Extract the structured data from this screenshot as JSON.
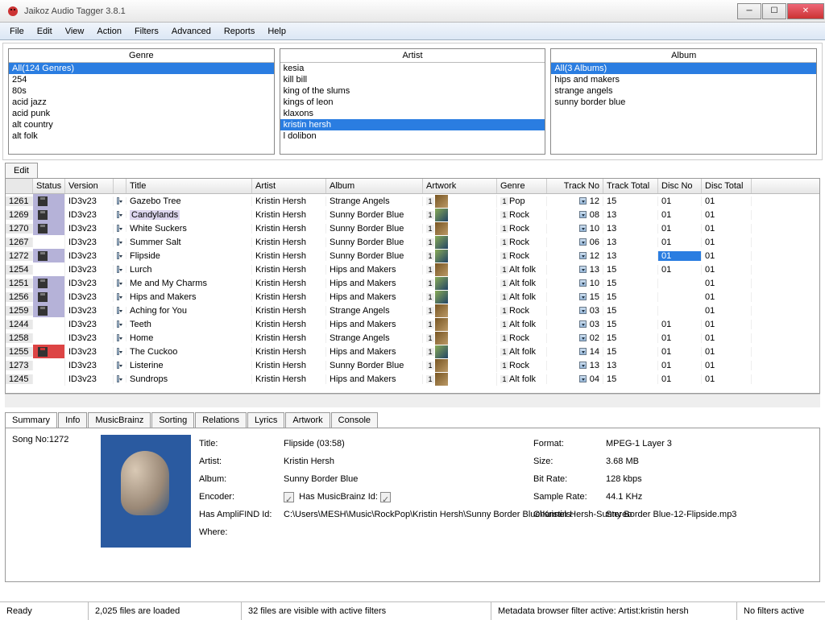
{
  "window": {
    "title": "Jaikoz Audio Tagger 3.8.1"
  },
  "menu": [
    "File",
    "Edit",
    "View",
    "Action",
    "Filters",
    "Advanced",
    "Reports",
    "Help"
  ],
  "filters": {
    "genre": {
      "title": "Genre",
      "items": [
        {
          "t": "All(124 Genres)",
          "sel": true
        },
        {
          "t": "254"
        },
        {
          "t": "80s"
        },
        {
          "t": "acid jazz"
        },
        {
          "t": "acid punk"
        },
        {
          "t": "alt country"
        },
        {
          "t": "alt folk"
        }
      ]
    },
    "artist": {
      "title": "Artist",
      "items": [
        {
          "t": "kesia"
        },
        {
          "t": "kill bill"
        },
        {
          "t": "king of the slums"
        },
        {
          "t": "kings of leon"
        },
        {
          "t": "klaxons"
        },
        {
          "t": "kristin hersh",
          "sel": true
        },
        {
          "t": "l dolibon"
        }
      ]
    },
    "album": {
      "title": "Album",
      "items": [
        {
          "t": "All(3 Albums)",
          "sel": true
        },
        {
          "t": "hips and makers"
        },
        {
          "t": "strange angels"
        },
        {
          "t": "sunny border blue"
        }
      ]
    }
  },
  "editTab": "Edit",
  "columns": [
    "",
    "Status",
    "Version",
    "",
    "Title",
    "Artist",
    "Album",
    "Artwork",
    "Genre",
    "Track No",
    "Track Total",
    "Disc No",
    "Disc Total"
  ],
  "rows": [
    {
      "id": "1261",
      "status": "m",
      "ver": "ID3v23",
      "title": "Gazebo Tree",
      "artist": "Kristin Hersh",
      "album": "Strange Angels",
      "genre": "Pop",
      "tn": "12",
      "tt": "15",
      "dn": "01",
      "dt": "01"
    },
    {
      "id": "1269",
      "status": "m",
      "ver": "ID3v23",
      "title": "Candylands",
      "hl": true,
      "artist": "Kristin Hersh",
      "album": "Sunny Border Blue",
      "genre": "Rock",
      "tn": "08",
      "tt": "13",
      "dn": "01",
      "dt": "01"
    },
    {
      "id": "1270",
      "status": "m",
      "ver": "ID3v23",
      "title": "White Suckers",
      "artist": "Kristin Hersh",
      "album": "Sunny Border Blue",
      "genre": "Rock",
      "tn": "10",
      "tt": "13",
      "dn": "01",
      "dt": "01"
    },
    {
      "id": "1267",
      "status": "",
      "ver": "ID3v23",
      "title": "Summer Salt",
      "artist": "Kristin Hersh",
      "album": "Sunny Border Blue",
      "genre": "Rock",
      "tn": "06",
      "tt": "13",
      "dn": "01",
      "dt": "01"
    },
    {
      "id": "1272",
      "status": "m",
      "ver": "ID3v23",
      "title": "Flipside",
      "artist": "Kristin Hersh",
      "album": "Sunny Border Blue",
      "genre": "Rock",
      "tn": "12",
      "tt": "13",
      "dn": "01",
      "dt": "01",
      "dnsel": true
    },
    {
      "id": "1254",
      "status": "",
      "ver": "ID3v23",
      "title": "Lurch",
      "artist": "Kristin Hersh",
      "album": "Hips and Makers",
      "genre": "Alt folk",
      "tn": "13",
      "tt": "15",
      "dn": "01",
      "dt": "01"
    },
    {
      "id": "1251",
      "status": "m",
      "ver": "ID3v23",
      "title": "Me and My Charms",
      "artist": "Kristin Hersh",
      "album": "Hips and Makers",
      "genre": "Alt folk",
      "tn": "10",
      "tt": "15",
      "dn": "",
      "dt": "01",
      "dnred": true
    },
    {
      "id": "1256",
      "status": "m",
      "ver": "ID3v23",
      "title": "Hips and Makers",
      "artist": "Kristin Hersh",
      "album": "Hips and Makers",
      "genre": "Alt folk",
      "tn": "15",
      "tt": "15",
      "dn": "",
      "dt": "01",
      "dnred": true
    },
    {
      "id": "1259",
      "status": "m",
      "ver": "ID3v23",
      "title": "Aching for You",
      "artist": "Kristin Hersh",
      "album": "Strange Angels",
      "genre": "Rock",
      "tn": "03",
      "tt": "15",
      "dn": "",
      "dt": "01",
      "dnred": true
    },
    {
      "id": "1244",
      "status": "",
      "ver": "ID3v23",
      "title": "Teeth",
      "artist": "Kristin Hersh",
      "album": "Hips and Makers",
      "genre": "Alt folk",
      "tn": "03",
      "tt": "15",
      "dn": "01",
      "dt": "01"
    },
    {
      "id": "1258",
      "status": "",
      "ver": "ID3v23",
      "title": "Home",
      "artist": "Kristin Hersh",
      "album": "Strange Angels",
      "genre": "Rock",
      "tn": "02",
      "tt": "15",
      "dn": "01",
      "dt": "01"
    },
    {
      "id": "1255",
      "status": "r",
      "ver": "ID3v23",
      "title": "The Cuckoo",
      "artist": "Kristin Hersh",
      "album": "Hips and Makers",
      "genre": "Alt folk",
      "tn": "14",
      "tt": "15",
      "dn": "01",
      "dt": "01"
    },
    {
      "id": "1273",
      "status": "",
      "ver": "ID3v23",
      "title": "Listerine",
      "artist": "Kristin Hersh",
      "album": "Sunny Border Blue",
      "genre": "Rock",
      "tn": "13",
      "tt": "13",
      "dn": "01",
      "dt": "01"
    },
    {
      "id": "1245",
      "status": "",
      "ver": "ID3v23",
      "title": "Sundrops",
      "artist": "Kristin Hersh",
      "album": "Hips and Makers",
      "genre": "Alt folk",
      "tn": "04",
      "tt": "15",
      "dn": "01",
      "dt": "01"
    }
  ],
  "detailTabs": [
    "Summary",
    "Info",
    "MusicBrainz",
    "Sorting",
    "Relations",
    "Lyrics",
    "Artwork",
    "Console"
  ],
  "detail": {
    "songNo": "Song No:1272",
    "labels": {
      "title": "Title:",
      "artist": "Artist:",
      "album": "Album:",
      "encoder": "Encoder:",
      "hasAmp": "Has AmpliFIND Id:",
      "hasMb": "Has MusicBrainz Id:",
      "where": "Where:",
      "format": "Format:",
      "size": "Size:",
      "bitrate": "Bit Rate:",
      "samplerate": "Sample Rate:",
      "channels": "Channels:"
    },
    "title": "Flipside (03:58)",
    "artist": "Kristin Hersh",
    "album": "Sunny Border Blue",
    "encoder": "",
    "format": "MPEG-1 Layer 3",
    "size": "3.68 MB",
    "bitrate": "128 kbps",
    "samplerate": "44.1 KHz",
    "channels": "Stereo",
    "where": "C:\\Users\\MESH\\Music\\RockPop\\Kristin Hersh\\Sunny Border Blue\\Kristin Hersh-Sunny Border Blue-12-Flipside.mp3"
  },
  "status": {
    "s1": "Ready",
    "s2": "2,025 files are loaded",
    "s3": "32 files are visible with active filters",
    "s4": "Metadata browser filter active: Artist:kristin hersh",
    "s5": "No filters active"
  }
}
